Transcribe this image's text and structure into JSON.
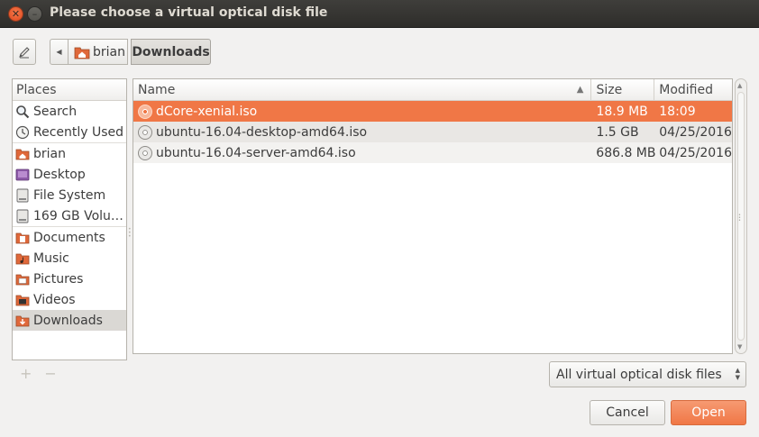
{
  "window": {
    "title": "Please choose a virtual optical disk file",
    "close_glyph": "✕",
    "min_glyph": "–"
  },
  "toolbar": {
    "edit_icon": "pencil-icon",
    "back_glyph": "◀",
    "crumbs": [
      "brian",
      "Downloads"
    ]
  },
  "places": {
    "header": "Places",
    "items": [
      {
        "label": "Search",
        "icon": "search-icon"
      },
      {
        "label": "Recently Used",
        "icon": "clock-icon"
      },
      {
        "label": "brian",
        "icon": "home-folder-icon"
      },
      {
        "label": "Desktop",
        "icon": "desktop-icon"
      },
      {
        "label": "File System",
        "icon": "drive-icon"
      },
      {
        "label": "169 GB Volu…",
        "icon": "drive-icon"
      },
      {
        "label": "Documents",
        "icon": "documents-folder-icon"
      },
      {
        "label": "Music",
        "icon": "music-folder-icon"
      },
      {
        "label": "Pictures",
        "icon": "pictures-folder-icon"
      },
      {
        "label": "Videos",
        "icon": "videos-folder-icon"
      },
      {
        "label": "Downloads",
        "icon": "downloads-folder-icon"
      }
    ],
    "add_label": "+",
    "remove_label": "−"
  },
  "filelist": {
    "columns": {
      "name": "Name",
      "size": "Size",
      "modified": "Modified"
    },
    "sort_arrow": "▲",
    "rows": [
      {
        "name": "dCore-xenial.iso",
        "size": "18.9 MB",
        "modified": "18:09"
      },
      {
        "name": "ubuntu-16.04-desktop-amd64.iso",
        "size": "1.5 GB",
        "modified": "04/25/2016"
      },
      {
        "name": "ubuntu-16.04-server-amd64.iso",
        "size": "686.8 MB",
        "modified": "04/25/2016"
      }
    ]
  },
  "filter": {
    "selected": "All virtual optical disk files"
  },
  "buttons": {
    "cancel": "Cancel",
    "open": "Open"
  },
  "colors": {
    "accent": "#f07746",
    "title_bg": "#3c3b37",
    "window_bg": "#f2f1f0"
  }
}
